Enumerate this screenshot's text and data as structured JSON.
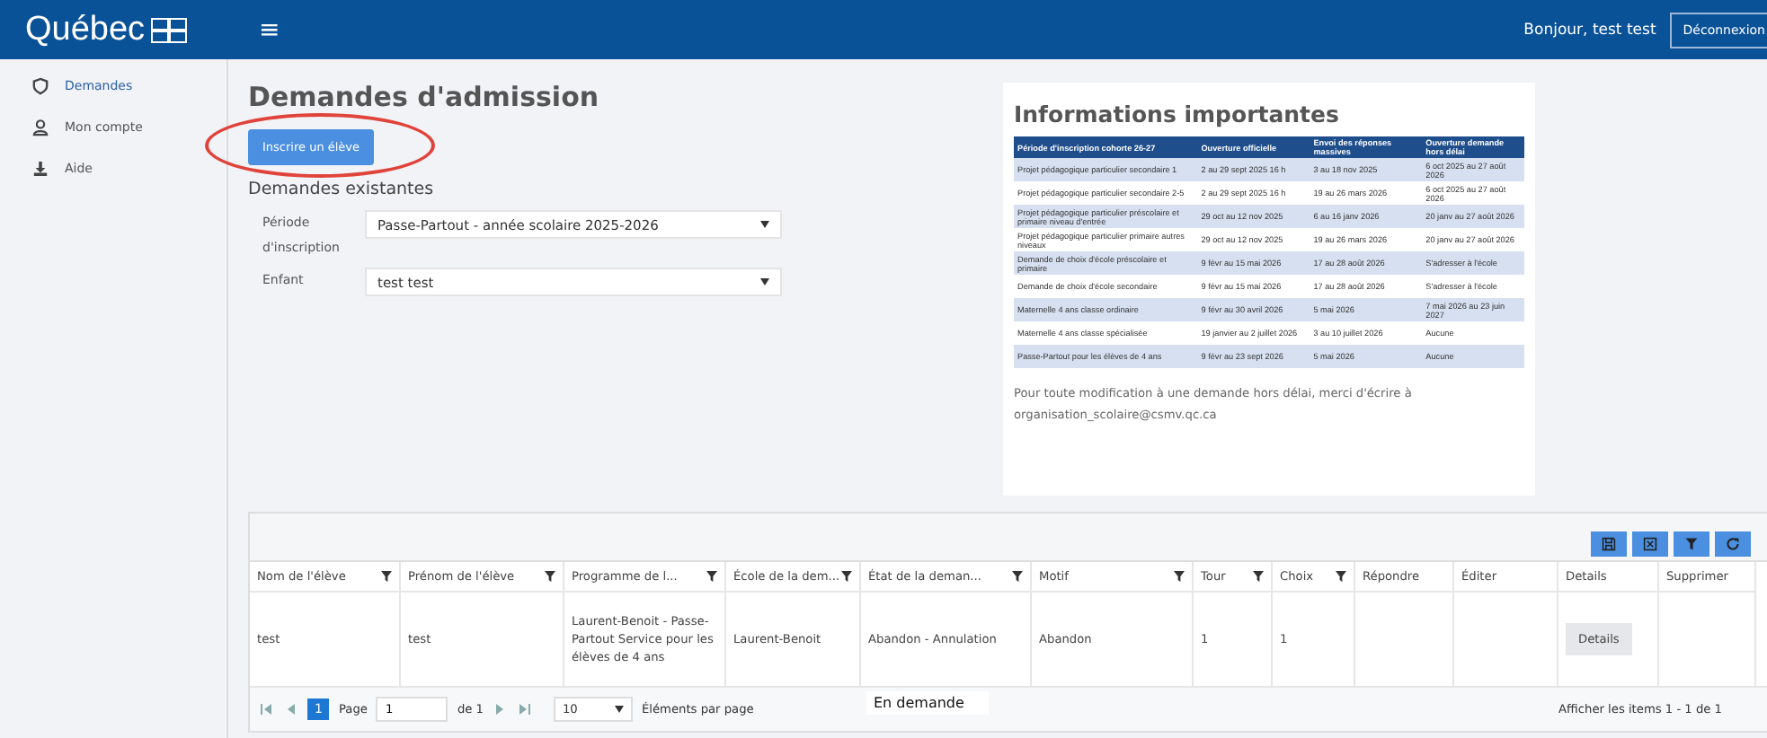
{
  "header": {
    "logo": "Québec",
    "menu": "≡",
    "greeting": "Bonjour, test test",
    "logout": "Déconnexion"
  },
  "sidebar": {
    "items": [
      {
        "label": "Demandes",
        "selected": true
      },
      {
        "label": "Mon compte",
        "selected": false
      },
      {
        "label": "Aide",
        "selected": false
      }
    ]
  },
  "main": {
    "title": "Demandes d'admission",
    "enroll_button": "Inscrire un élève",
    "section_title": "Demandes existantes",
    "fields": [
      {
        "label": "Période d'inscription",
        "value": "Passe-Partout - année scolaire 2025-2026"
      },
      {
        "label": "Enfant",
        "value": "test test"
      }
    ]
  },
  "info": {
    "title": "Informations importantes",
    "columns": [
      "Période d'inscription cohorte 26-27",
      "Ouverture officielle",
      "Envoi des réponses massives",
      "Ouverture demande hors délai"
    ],
    "rows": [
      {
        "highlighted": true,
        "cells": [
          "Projet pédagogique particulier secondaire 1",
          "2 au 29 sept 2025 16 h",
          "3 au 18 nov 2025",
          "6 oct 2025 au 27 août 2026"
        ]
      },
      {
        "highlighted": false,
        "cells": [
          "Projet pédagogique particulier secondaire 2-5",
          "2 au 29 sept 2025 16 h",
          "19 au 26 mars 2026",
          "6 oct 2025 au 27 août 2026"
        ]
      },
      {
        "highlighted": true,
        "cells": [
          "Projet pédagogique particulier préscolaire et primaire niveau d'entrée",
          "29 oct au 12 nov 2025",
          "6 au 16 janv 2026",
          "20 janv au 27 août 2026"
        ]
      },
      {
        "highlighted": false,
        "cells": [
          "Projet pédagogique particulier primaire autres niveaux",
          "29 oct au 12 nov 2025",
          "19 au 26 mars 2026",
          "20 janv au 27 août 2026"
        ]
      },
      {
        "highlighted": true,
        "cells": [
          "Demande de choix d'école préscolaire et primaire",
          "9 févr au 15 mai 2026",
          "17 au 28 août 2026",
          "S'adresser à l'école"
        ]
      },
      {
        "highlighted": false,
        "cells": [
          "Demande de choix d'école secondaire",
          "9 févr au 15 mai 2026",
          "17 au 28 août 2026",
          "S'adresser à l'école"
        ]
      },
      {
        "highlighted": true,
        "cells": [
          "Maternelle 4 ans classe ordinaire",
          "9 févr au 30 avril 2026",
          "5 mai 2026",
          "7 mai 2026 au 23 juin 2027"
        ]
      },
      {
        "highlighted": false,
        "cells": [
          "Maternelle 4 ans classe spécialisée",
          "19 janvier au 2 juillet 2026",
          "3 au 10 juillet 2026",
          "Aucune"
        ]
      },
      {
        "highlighted": true,
        "cells": [
          "Passe-Partout pour les élèves de 4 ans",
          "9 févr au 23 sept 2026",
          "5 mai 2026",
          "Aucune"
        ]
      }
    ],
    "note": "Pour toute modification à une demande hors délai, merci d'écrire à organisation_scolaire@csmv.qc.ca"
  },
  "grid": {
    "columns": [
      {
        "label": "Nom de l'élève",
        "filterable": true
      },
      {
        "label": "Prénom de l'élève",
        "filterable": true
      },
      {
        "label": "Programme de l...",
        "filterable": true
      },
      {
        "label": "École de la dem...",
        "filterable": true
      },
      {
        "label": "État de la deman...",
        "filterable": true
      },
      {
        "label": "Motif",
        "filterable": true
      },
      {
        "label": "Tour",
        "filterable": true
      },
      {
        "label": "Choix",
        "filterable": true
      },
      {
        "label": "Répondre",
        "filterable": false
      },
      {
        "label": "Éditer",
        "filterable": false
      },
      {
        "label": "Details",
        "filterable": false
      },
      {
        "label": "Supprimer",
        "filterable": false
      }
    ],
    "rows": [
      {
        "cells": [
          {
            "kind": "text",
            "text": "test"
          },
          {
            "kind": "text",
            "text": "test"
          },
          {
            "kind": "text",
            "text": "Laurent-Benoit - Passe-Partout Service pour les élèves de 4 ans"
          },
          {
            "kind": "text",
            "text": "Laurent-Benoit"
          },
          {
            "kind": "text",
            "text": "Abandon - Annulation"
          },
          {
            "kind": "text",
            "text": "Abandon"
          },
          {
            "kind": "text",
            "text": "1"
          },
          {
            "kind": "text",
            "text": "1"
          },
          {
            "kind": "empty"
          },
          {
            "kind": "empty"
          },
          {
            "kind": "button",
            "text": "Details"
          },
          {
            "kind": "empty"
          }
        ]
      }
    ],
    "pager": {
      "pages": [
        {
          "label": "1",
          "selected": true
        }
      ],
      "page_label": "Page",
      "page_value": "1",
      "page_total": "de 1",
      "page_size": "10",
      "page_size_label": "Éléments par page",
      "summary": "Afficher les items 1 - 1 de 1"
    }
  },
  "overlay_label": "En demande"
}
